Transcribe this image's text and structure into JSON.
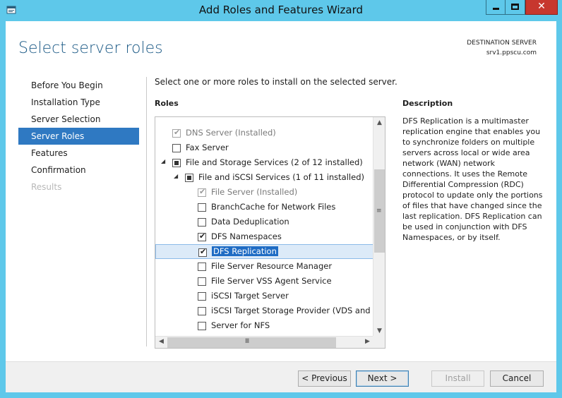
{
  "window": {
    "title": "Add Roles and Features Wizard",
    "close_glyph": "✕"
  },
  "header": {
    "page_title": "Select server roles",
    "destination_label": "DESTINATION SERVER",
    "destination_server": "srv1.ppscu.com"
  },
  "nav": {
    "items": [
      {
        "label": "Before You Begin",
        "state": "normal"
      },
      {
        "label": "Installation Type",
        "state": "normal"
      },
      {
        "label": "Server Selection",
        "state": "normal"
      },
      {
        "label": "Server Roles",
        "state": "active"
      },
      {
        "label": "Features",
        "state": "normal"
      },
      {
        "label": "Confirmation",
        "state": "normal"
      },
      {
        "label": "Results",
        "state": "disabled"
      }
    ]
  },
  "main": {
    "instruction": "Select one or more roles to install on the selected server.",
    "roles_heading": "Roles",
    "description_heading": "Description",
    "description": "DFS Replication is a multimaster replication engine that enables you to synchronize folders on multiple servers across local or wide area network (WAN) network connections. It uses the Remote Differential Compression (RDC) protocol to update only the portions of files that have changed since the last replication. DFS Replication can be used in conjunction with DFS Namespaces, or by itself."
  },
  "roles": [
    {
      "label": "DNS Server (Installed)",
      "checked": "checked",
      "disabled": true,
      "expander": ""
    },
    {
      "label": "Fax Server",
      "checked": "unchecked",
      "disabled": false,
      "expander": ""
    },
    {
      "label": "File and Storage Services (2 of 12 installed)",
      "checked": "partial",
      "disabled": false,
      "expander": "◢"
    },
    {
      "label": "File and iSCSI Services (1 of 11 installed)",
      "checked": "partial",
      "disabled": false,
      "expander": "◢"
    },
    {
      "label": "File Server (Installed)",
      "checked": "checked",
      "disabled": true,
      "expander": ""
    },
    {
      "label": "BranchCache for Network Files",
      "checked": "unchecked",
      "disabled": false,
      "expander": ""
    },
    {
      "label": "Data Deduplication",
      "checked": "unchecked",
      "disabled": false,
      "expander": ""
    },
    {
      "label": "DFS Namespaces",
      "checked": "checked",
      "disabled": false,
      "expander": ""
    },
    {
      "label": "DFS Replication",
      "checked": "checked",
      "disabled": false,
      "expander": "",
      "selected": true
    },
    {
      "label": "File Server Resource Manager",
      "checked": "unchecked",
      "disabled": false,
      "expander": ""
    },
    {
      "label": "File Server VSS Agent Service",
      "checked": "unchecked",
      "disabled": false,
      "expander": ""
    },
    {
      "label": "iSCSI Target Server",
      "checked": "unchecked",
      "disabled": false,
      "expander": ""
    },
    {
      "label": "iSCSI Target Storage Provider (VDS and VSS",
      "checked": "unchecked",
      "disabled": false,
      "expander": ""
    },
    {
      "label": "Server for NFS",
      "checked": "unchecked",
      "disabled": false,
      "expander": ""
    }
  ],
  "scroll": {
    "up": "▲",
    "down": "▼",
    "left": "◀",
    "right": "▶",
    "v_grip": "≡",
    "h_grip": "Ⅲ"
  },
  "glyphs": {
    "check": "✔"
  },
  "footer": {
    "previous": "< Previous",
    "next": "Next >",
    "install": "Install",
    "cancel": "Cancel"
  }
}
